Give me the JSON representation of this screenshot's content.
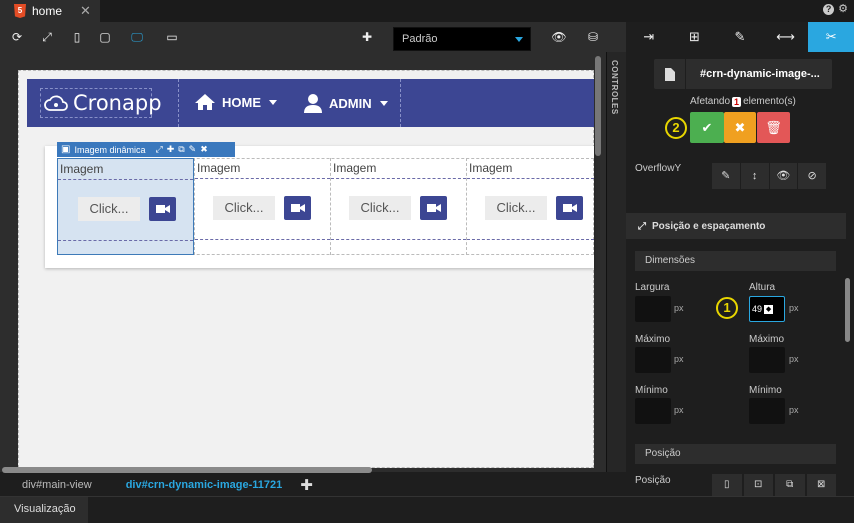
{
  "tabbar": {
    "tab_title": "home",
    "tab_close": "✕",
    "html5_badge": "5",
    "help_glyph": "?",
    "gear_glyph": "⚙"
  },
  "toolbar": {
    "reload": "⟳",
    "expand": "⤢",
    "phone": "▯",
    "tablet": "▢",
    "desktop": "🖵",
    "monitor": "▭",
    "add": "✚",
    "profile_value": "Padrão",
    "preview_eye": "👁",
    "db": "⛁"
  },
  "canvas": {
    "logo_text": "Cronapp",
    "nav_home": "HOME",
    "nav_admin": "ADMIN",
    "selection_label": "Imagem dinâmica",
    "selection_tools": [
      "⤢",
      "✚",
      "⧉",
      "✎",
      "✖"
    ],
    "columns": [
      {
        "label": "Imagem",
        "click": "Click..."
      },
      {
        "label": "Imagem",
        "click": "Click..."
      },
      {
        "label": "Imagem",
        "click": "Click..."
      },
      {
        "label": "Imagem",
        "click": "Click..."
      }
    ],
    "controls_label": "CONTROLES"
  },
  "breadcrumb": {
    "items": [
      "div#main-view",
      "div#crn-dynamic-image-11721"
    ],
    "add": "✚"
  },
  "footer": {
    "tab": "Visualização"
  },
  "rpanel": {
    "tabs": [
      "⇥",
      "⊞",
      "✎",
      "⟷",
      "✂"
    ],
    "element_id": "#crn-dynamic-image-...",
    "affecting_prefix": "Afetando",
    "affecting_count": "1",
    "affecting_suffix": "elemento(s)",
    "confirm": "✔",
    "cancel": "✖",
    "delete": "🗑",
    "marker_1": "1",
    "marker_2": "2",
    "overflow_label": "OverflowY",
    "overflow_btns": [
      "✎",
      "↕",
      "👁",
      "⊘"
    ],
    "section_title": "Posição e espaçamento",
    "dimensions_title": "Dimensões",
    "width_label": "Largura",
    "height_label": "Altura",
    "max_label_w": "Máximo",
    "max_label_h": "Máximo",
    "min_label_w": "Mínimo",
    "min_label_h": "Mínimo",
    "unit": "px",
    "height_value": "49",
    "position_title": "Posição",
    "position_label": "Posição",
    "position_btns": [
      "▯",
      "⊡",
      "⧉",
      "⊠"
    ]
  },
  "colors": {
    "accent": "#2aa7e0",
    "navbar": "#3c4693",
    "confirm": "#4caf50",
    "cancel": "#f0a020",
    "delete": "#e35757",
    "marker": "#e8d600"
  }
}
